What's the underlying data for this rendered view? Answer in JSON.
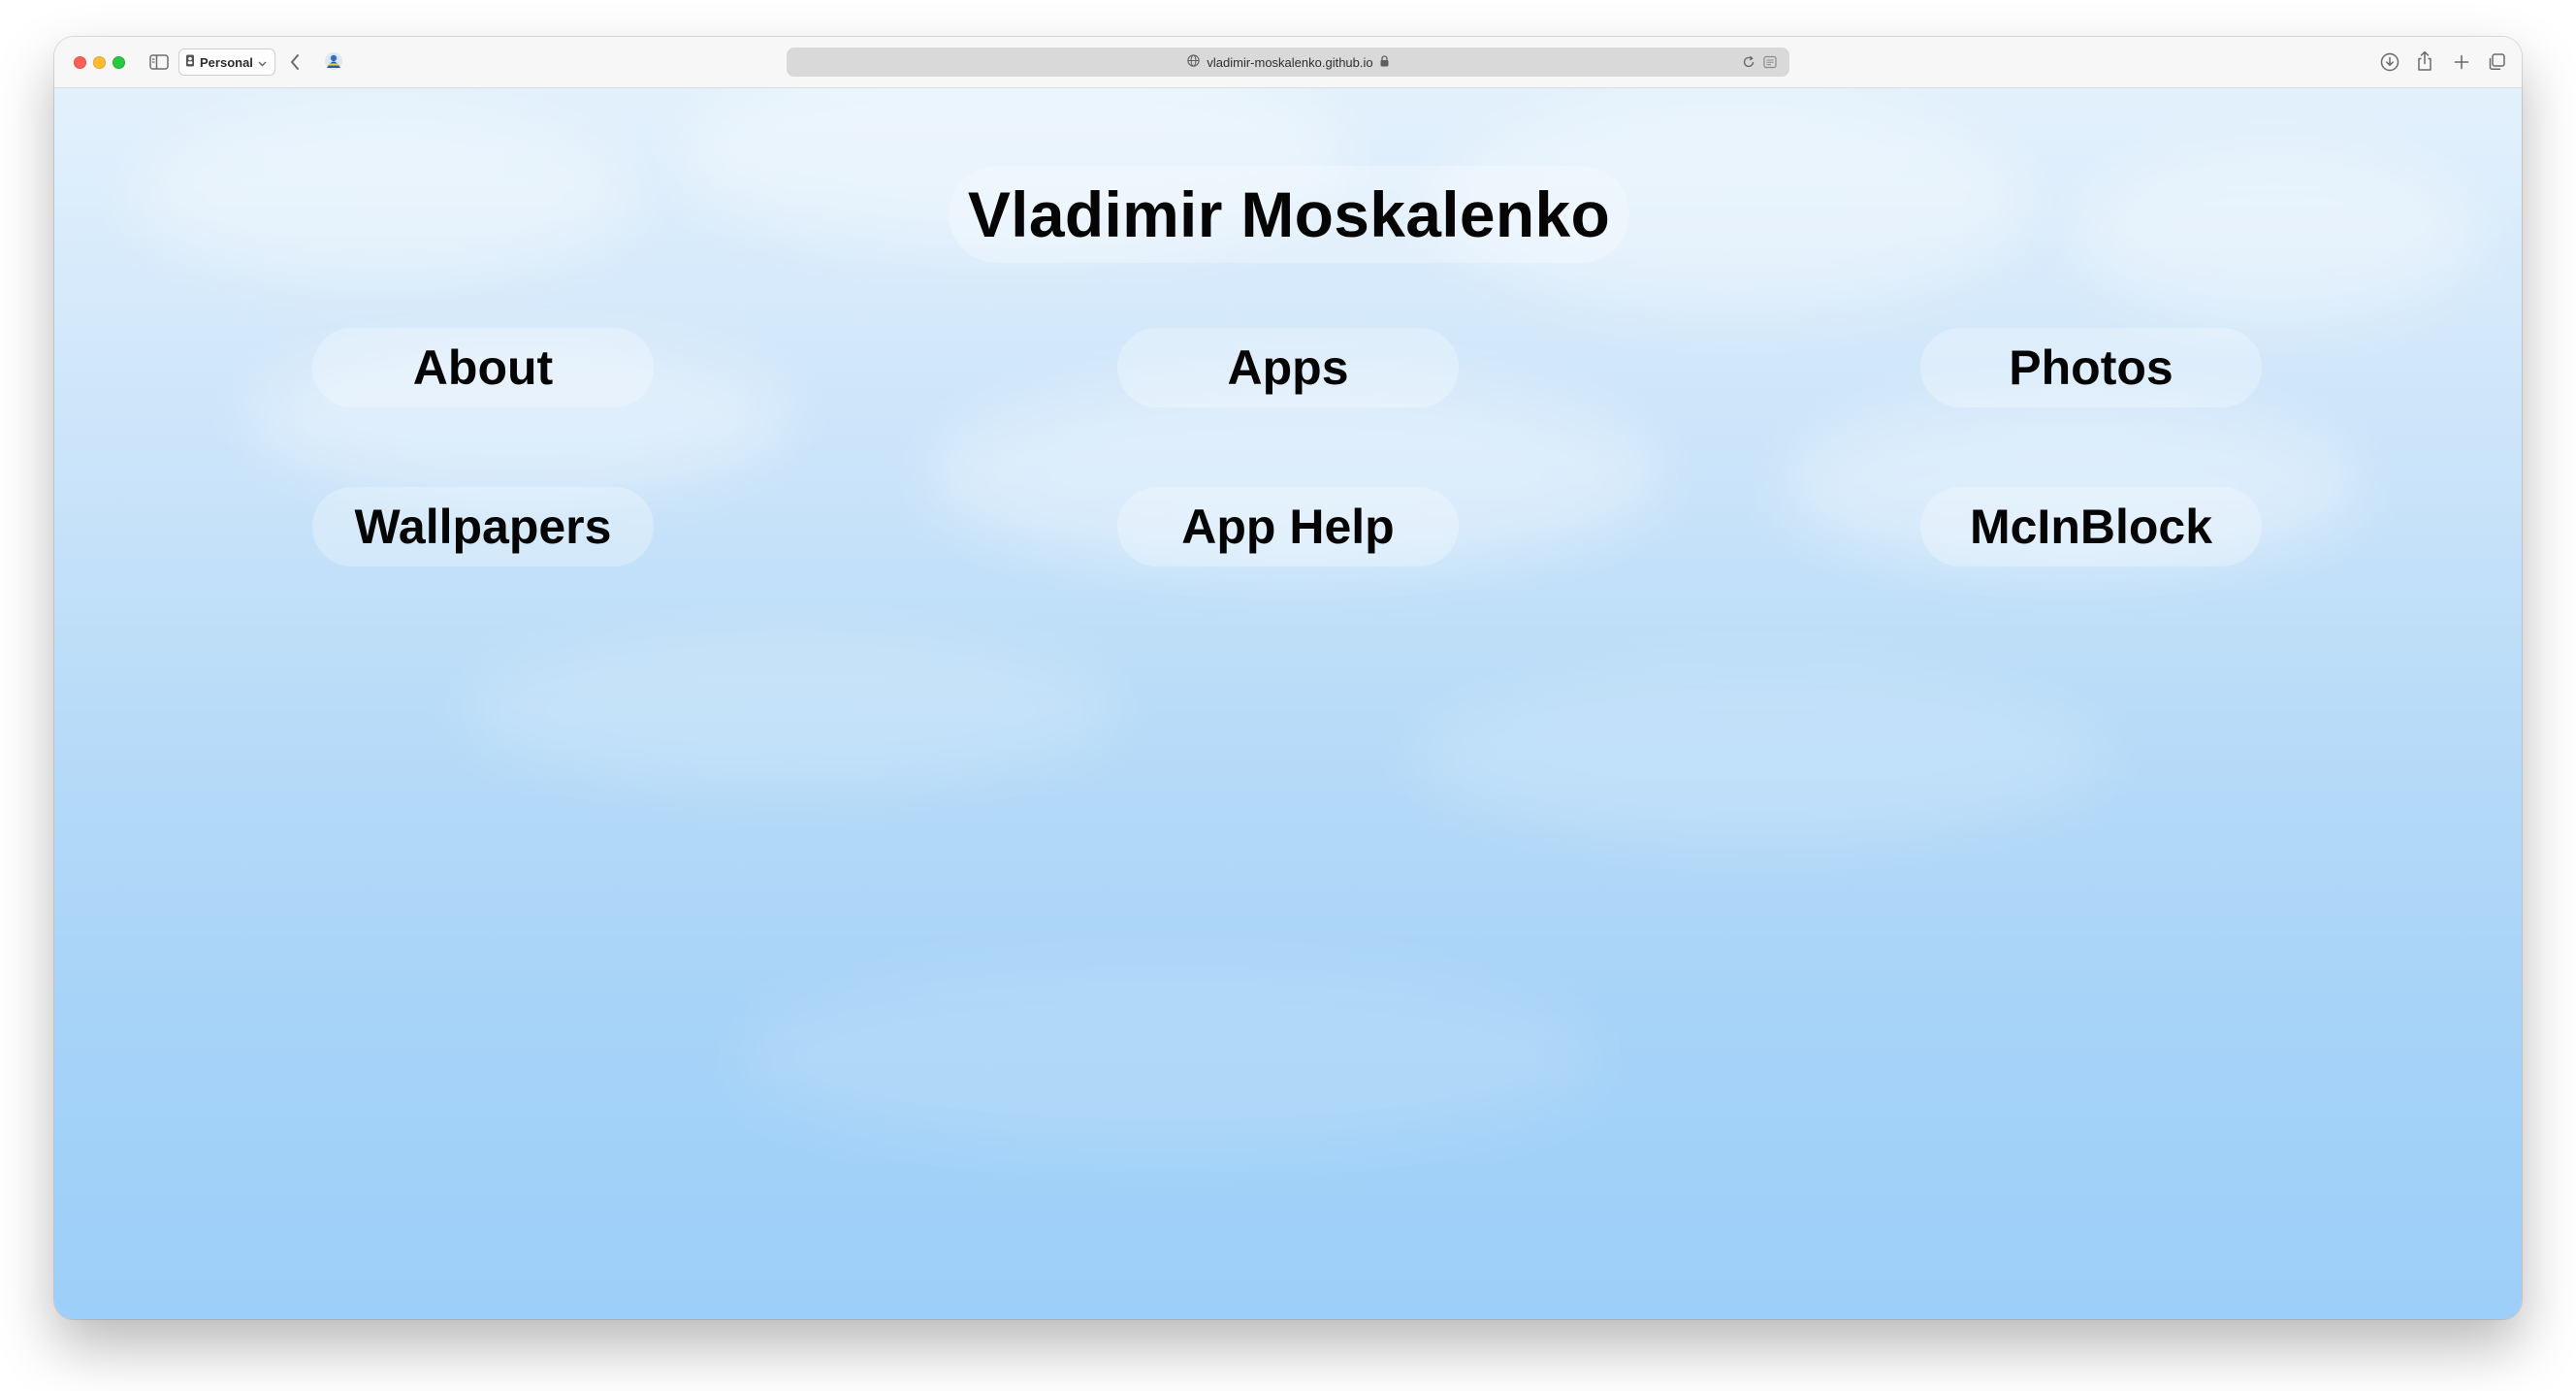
{
  "browser": {
    "profile_label": "Personal",
    "url": "vladimir-moskalenko.github.io",
    "icons": {
      "sidebar": "sidebar-icon",
      "profile": "person-icon",
      "back": "chevron-left-icon",
      "site": "site-avatar-icon",
      "globe": "globe-icon",
      "lock": "lock-icon",
      "reload": "reload-icon",
      "reader": "reader-icon",
      "download": "download-icon",
      "share": "share-icon",
      "new_tab": "plus-icon",
      "tab_overview": "tabs-icon"
    }
  },
  "page": {
    "title": "Vladimir Moskalenko",
    "nav": [
      {
        "label": "About"
      },
      {
        "label": "Apps"
      },
      {
        "label": "Photos"
      },
      {
        "label": "Wallpapers"
      },
      {
        "label": "App Help"
      },
      {
        "label": "McInBlock"
      }
    ]
  },
  "colors": {
    "sky_top": "#e3f1fc",
    "sky_bottom": "#9ccff9",
    "text": "#050505"
  }
}
